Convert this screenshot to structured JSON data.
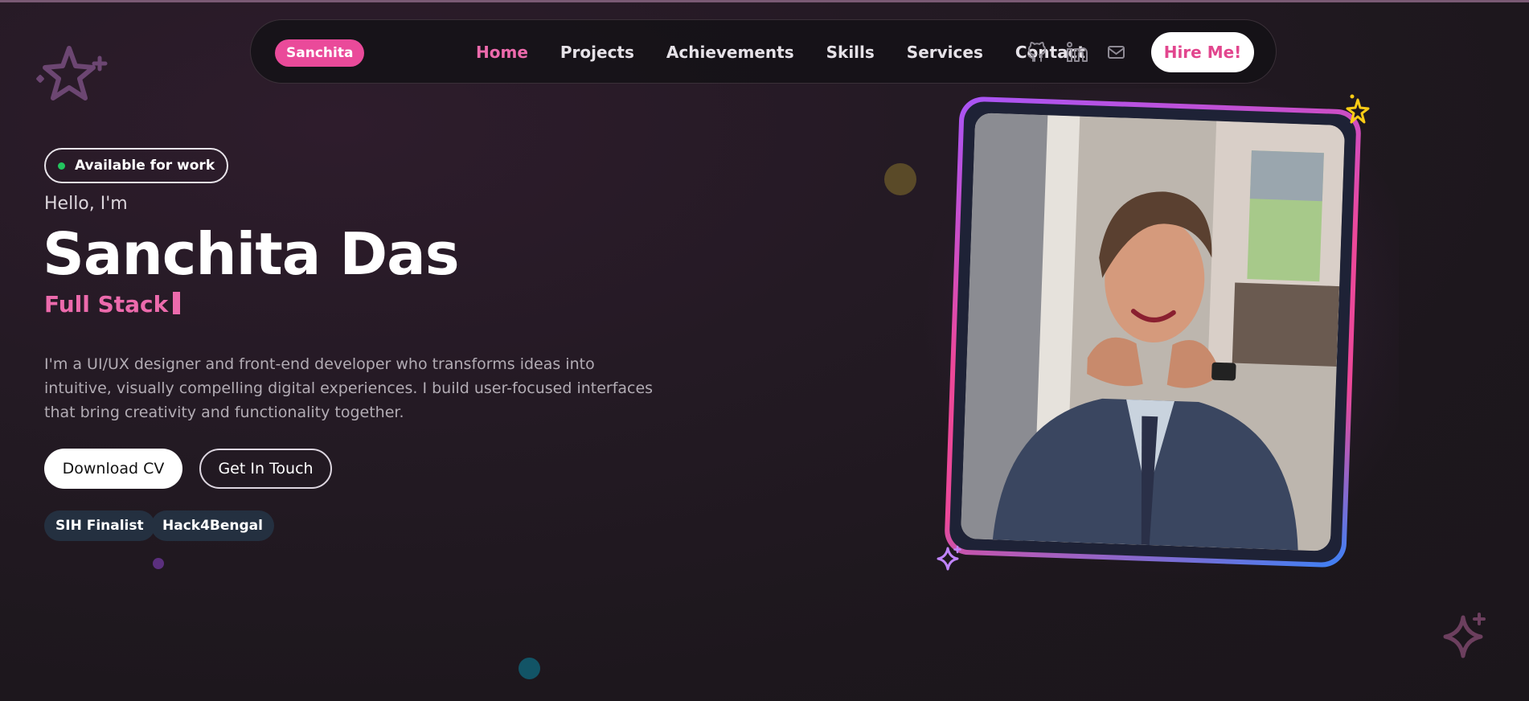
{
  "nav": {
    "brand": "Sanchita",
    "links": [
      "Home",
      "Projects",
      "Achievements",
      "Skills",
      "Services",
      "Contact"
    ],
    "active": "Home",
    "social_icons": [
      "github-icon",
      "linkedin-icon",
      "mail-icon"
    ],
    "hire_label": "Hire Me!"
  },
  "hero": {
    "status_badge": "Available for work",
    "greeting": "Hello, I'm",
    "name": "Sanchita Das",
    "typed_role": "Full Stack",
    "bio": "I'm a UI/UX designer and front-end developer who transforms ideas into intuitive, visually compelling digital experiences. I build user-focused interfaces that bring creativity and functionality together.",
    "primary_button": "Download CV",
    "secondary_button": "Get In Touch",
    "tags": [
      "SIH Finalist",
      "Hack4Bengal"
    ]
  },
  "colors": {
    "accent": "#ec6aac",
    "brand_pink": "#ea4a9a",
    "status_green": "#22c55e",
    "tag_bg": "#243040",
    "frame_gradient": [
      "#a855f7",
      "#ec4899",
      "#3b82f6"
    ]
  }
}
